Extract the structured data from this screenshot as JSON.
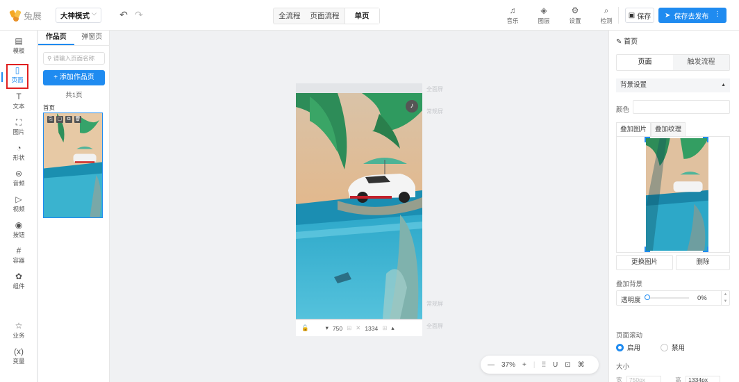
{
  "app": {
    "logo_text": "兔展",
    "mode": "大神模式"
  },
  "flow_tabs": [
    "全流程",
    "页面流程",
    "单页"
  ],
  "toolbar": [
    {
      "icon": "music-icon",
      "label": "音乐"
    },
    {
      "icon": "layers-icon",
      "label": "图层"
    },
    {
      "icon": "settings-icon",
      "label": "设置"
    },
    {
      "icon": "inspect-icon",
      "label": "检测"
    }
  ],
  "save_label": "保存",
  "publish_label": "保存去发布",
  "iconbar": [
    {
      "icon": "template-icon",
      "label": "模板"
    },
    {
      "icon": "page-icon",
      "label": "页面"
    },
    {
      "icon": "text-icon",
      "label": "文本"
    },
    {
      "icon": "image-icon",
      "label": "图片"
    },
    {
      "icon": "shape-icon",
      "label": "形状"
    },
    {
      "icon": "audio-icon",
      "label": "音频"
    },
    {
      "icon": "video-icon",
      "label": "视频"
    },
    {
      "icon": "button-icon",
      "label": "按钮"
    },
    {
      "icon": "container-icon",
      "label": "容器"
    },
    {
      "icon": "component-icon",
      "label": "组件"
    },
    {
      "icon": "business-icon",
      "label": "业务"
    },
    {
      "icon": "variable-icon",
      "label": "变量"
    }
  ],
  "pagepanel": {
    "tabs": [
      "作品页",
      "弹窗页"
    ],
    "search_placeholder": "请输入页面名称",
    "add_label": "+ 添加作品页",
    "count_label": "共1页",
    "page_name": "首页"
  },
  "canvas": {
    "labels": [
      "全面屏",
      "常规屏",
      "常规屏",
      "全面屏"
    ],
    "width_value": "750",
    "height_value": "1334"
  },
  "zoom": {
    "minus": "—",
    "value": "37%",
    "plus": "+"
  },
  "rpanel": {
    "title": "首页",
    "seg": [
      "页面",
      "触发流程"
    ],
    "bg_section": "背景设置",
    "color_label": "颜色",
    "overlay_tabs": [
      "叠加图片",
      "叠加纹理"
    ],
    "replace_btn": "更换图片",
    "delete_btn": "删除",
    "overlay_bg_label": "叠加背景",
    "opacity_label": "透明度",
    "opacity_value": "0%",
    "scroll_label": "页面滚动",
    "enable_label": "启用",
    "disable_label": "禁用",
    "size_label": "大小",
    "size_width_label": "宽",
    "size_width_value": "750px",
    "size_height_label": "高",
    "size_height_value": "1334px"
  },
  "colors": {
    "accent": "#1f8bf0",
    "highlight": "#e02020"
  }
}
